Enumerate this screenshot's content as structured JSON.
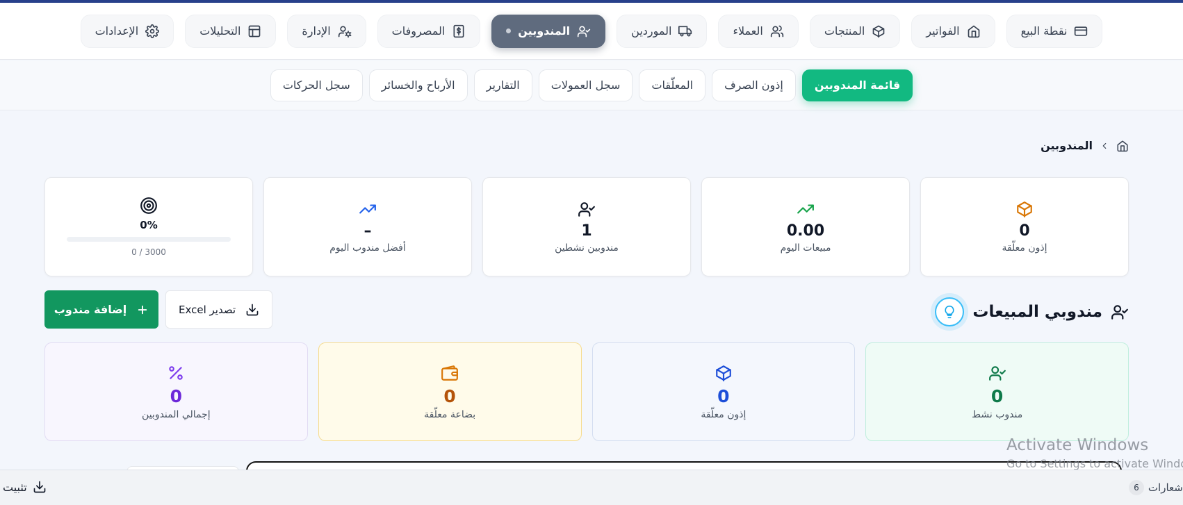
{
  "topnav": {
    "items": [
      {
        "label": "نقطة البيع",
        "icon": "credit-card-icon"
      },
      {
        "label": "الفواتير",
        "icon": "home-icon"
      },
      {
        "label": "المنتجات",
        "icon": "box-icon"
      },
      {
        "label": "العملاء",
        "icon": "users-icon"
      },
      {
        "label": "الموردين",
        "icon": "truck-icon"
      },
      {
        "label": "المندوبين",
        "icon": "user-check-icon",
        "active": true
      },
      {
        "label": "المصروفات",
        "icon": "dollar-receipt-icon"
      },
      {
        "label": "الإدارة",
        "icon": "user-cog-icon"
      },
      {
        "label": "التحليلات",
        "icon": "layout-icon"
      },
      {
        "label": "الإعدادات",
        "icon": "gear-icon"
      }
    ]
  },
  "subnav": {
    "items": [
      {
        "label": "قائمة المندوبين",
        "active": true
      },
      {
        "label": "إذون الصرف"
      },
      {
        "label": "المعلّقات"
      },
      {
        "label": "سجل العمولات"
      },
      {
        "label": "التقارير"
      },
      {
        "label": "الأرباح والخسائر"
      },
      {
        "label": "سجل الحركات"
      }
    ]
  },
  "breadcrumb": {
    "current": "المندوبين",
    "home_icon": "home-icon",
    "separator_icon": "chevron-icon"
  },
  "stats": {
    "pending_permits": {
      "value": "0",
      "label": "إذون معلّقة",
      "icon": "box-icon",
      "color": "#d97706"
    },
    "today_sales": {
      "value": "0.00",
      "label": "مبيعات اليوم",
      "icon": "trending-up-icon",
      "color": "#16a34a"
    },
    "active_reps": {
      "value": "1",
      "label": "مندوبين نشطين",
      "icon": "user-check-icon",
      "color": "#111827"
    },
    "best_rep": {
      "value": "–",
      "label": "أفضل مندوب اليوم",
      "icon": "trending-up-icon",
      "color": "#2563eb"
    },
    "target": {
      "percent": "0%",
      "progress": 0,
      "ratio": "3000 / 0",
      "icon": "target-icon"
    }
  },
  "section": {
    "title": "مندوبي المبيعات",
    "icon": "user-check-icon",
    "hint_icon": "lightbulb-icon"
  },
  "actions": {
    "add_label": "إضافة مندوب",
    "export_label": "تصدير Excel"
  },
  "summary": [
    {
      "value": "0",
      "label": "مندوب نشط",
      "icon": "user-check-icon"
    },
    {
      "value": "0",
      "label": "إذون معلّقة",
      "icon": "box-icon"
    },
    {
      "value": "0",
      "label": "بضاعة معلّقة",
      "icon": "wallet-icon"
    },
    {
      "value": "0",
      "label": "إجمالي المندوبين",
      "icon": "percent-icon"
    }
  ],
  "bottombar": {
    "install_label": "تثبيت",
    "notifications_label": "إشعارات",
    "notifications_count": "6"
  },
  "watermark": {
    "line1": "Activate Windows",
    "line2": "Go to Settings to activate Windows."
  }
}
